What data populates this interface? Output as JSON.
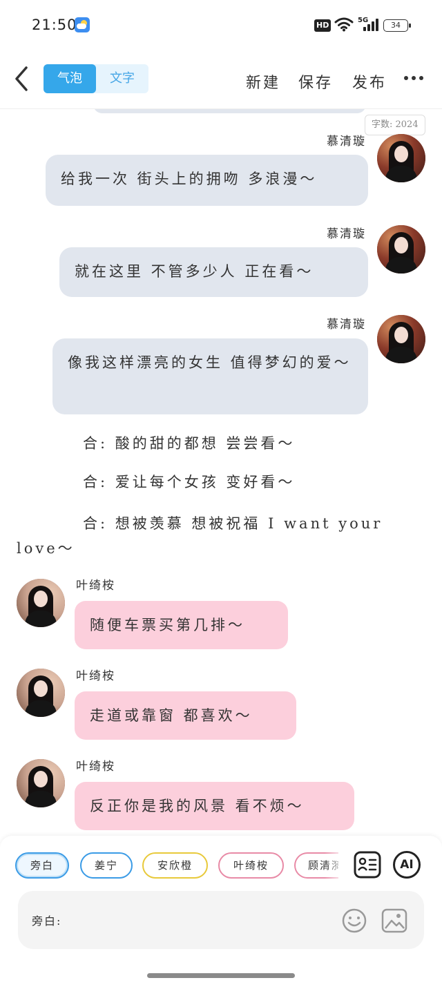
{
  "status_bar": {
    "time": "21:50",
    "network": "5G",
    "hd": "HD",
    "battery": "34"
  },
  "header": {
    "mode_tabs": [
      "气泡",
      "文字"
    ],
    "actions": [
      "新建",
      "保存",
      "发布"
    ]
  },
  "word_count": "字数: 2024",
  "messages": [
    {
      "speaker": "慕清璇",
      "text": "给我一次 街头上的拥吻 多浪漫～"
    },
    {
      "speaker": "慕清璇",
      "text": "就在这里 不管多少人 正在看～"
    },
    {
      "speaker": "慕清璇",
      "text": "像我这样漂亮的女生 值得梦幻的爱～"
    }
  ],
  "narration": [
    "合: 酸的甜的都想 尝尝看～",
    "合: 爱让每个女孩 变好看～",
    "合: 想被羡慕 想被祝福 I want your love～"
  ],
  "left_messages": [
    {
      "speaker": "叶绮桉",
      "text": "随便车票买第几排～"
    },
    {
      "speaker": "叶绮桉",
      "text": "走道或靠窗 都喜欢～"
    },
    {
      "speaker": "叶绮桉",
      "text": "反正你是我的风景 看不烦～"
    }
  ],
  "characters": [
    {
      "label": "旁白",
      "color": "#3a9be6",
      "selected": true
    },
    {
      "label": "姜宁",
      "color": "#3a9be6",
      "selected": false
    },
    {
      "label": "安欣橙",
      "color": "#e8c93a",
      "selected": false
    },
    {
      "label": "叶绮桉",
      "color": "#e88aa6",
      "selected": false
    },
    {
      "label": "顾清漪",
      "color": "#e88aa6",
      "selected": false
    }
  ],
  "tools": [
    "character-card-icon",
    "AI"
  ],
  "input": {
    "label": "旁白:"
  },
  "icons": {
    "emoji": "smiley-icon",
    "image": "image-icon"
  }
}
